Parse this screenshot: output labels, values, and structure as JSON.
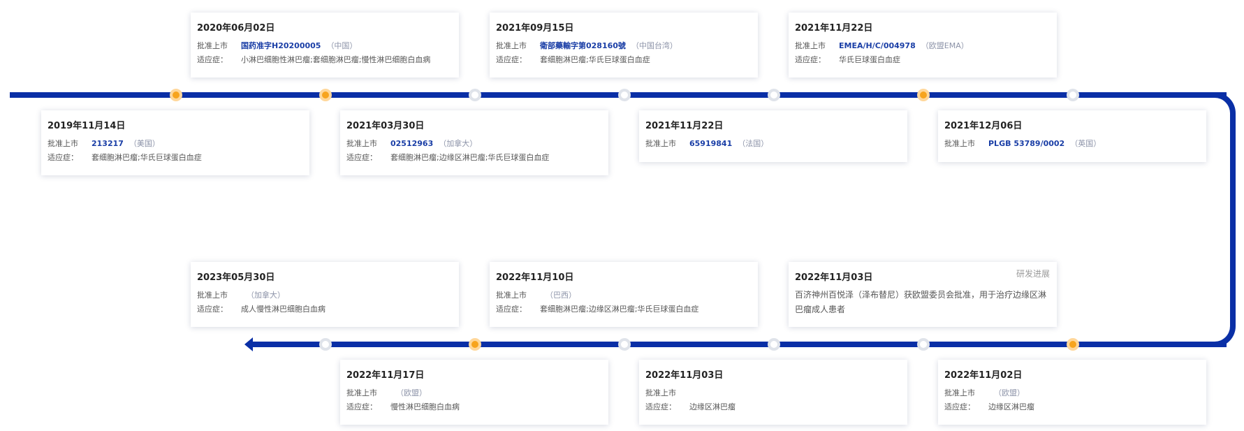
{
  "research_tag": "研发进展",
  "cards_top_above": [
    {
      "date": "2020年06月02日",
      "label": "批准上市",
      "code": "国药准字H20200005",
      "country": "（中国）",
      "ind_label": "适应症：",
      "indication": "小淋巴细胞性淋巴瘤;套细胞淋巴瘤;慢性淋巴细胞白血病"
    },
    {
      "date": "2021年09月15日",
      "label": "批准上市",
      "code": "衛部藥輸字第028160號",
      "country": "（中国台湾）",
      "ind_label": "适应症：",
      "indication": "套细胞淋巴瘤;华氏巨球蛋白血症"
    },
    {
      "date": "2021年11月22日",
      "label": "批准上市",
      "code": "EMEA/H/C/004978",
      "country": "（欧盟EMA）",
      "ind_label": "适应症：",
      "indication": "华氏巨球蛋白血症"
    }
  ],
  "cards_top_below": [
    {
      "date": "2019年11月14日",
      "label": "批准上市",
      "code": "213217",
      "country": "（美国）",
      "ind_label": "适应症：",
      "indication": "套细胞淋巴瘤;华氏巨球蛋白血症"
    },
    {
      "date": "2021年03月30日",
      "label": "批准上市",
      "code": "02512963",
      "country": "（加拿大）",
      "ind_label": "适应症：",
      "indication": "套细胞淋巴瘤;边缘区淋巴瘤;华氏巨球蛋白血症"
    },
    {
      "date": "2021年11月22日",
      "label": "批准上市",
      "code": "65919841",
      "country": "（法国）"
    },
    {
      "date": "2021年12月06日",
      "label": "批准上市",
      "code": "PLGB 53789/0002",
      "country": "（英国）"
    }
  ],
  "cards_bottom_above": [
    {
      "date": "2023年05月30日",
      "label": "批准上市",
      "code": "",
      "country": "（加拿大）",
      "ind_label": "适应症：",
      "indication": "成人慢性淋巴细胞白血病"
    },
    {
      "date": "2022年11月10日",
      "label": "批准上市",
      "code": "",
      "country": "（巴西）",
      "ind_label": "适应症：",
      "indication": "套细胞淋巴瘤;边缘区淋巴瘤;华氏巨球蛋白血症"
    },
    {
      "date": "2022年11月03日",
      "description": "百济神州百悦泽（泽布替尼）获欧盟委员会批准，用于治疗边缘区淋巴瘤成人患者"
    }
  ],
  "cards_bottom_below": [
    {
      "date": "2022年11月17日",
      "label": "批准上市",
      "code": "",
      "country": "（欧盟）",
      "ind_label": "适应症：",
      "indication": "慢性淋巴细胞白血病"
    },
    {
      "date": "2022年11月03日",
      "label": "批准上市",
      "ind_label": "适应症：",
      "indication": "边缘区淋巴瘤"
    },
    {
      "date": "2022年11月02日",
      "label": "批准上市",
      "code": "",
      "country": "（欧盟）",
      "ind_label": "适应症：",
      "indication": "边缘区淋巴瘤"
    }
  ],
  "colors": {
    "track": "#0a2fa6",
    "node_active": "#f7a41d",
    "code": "#1a3ea6"
  }
}
